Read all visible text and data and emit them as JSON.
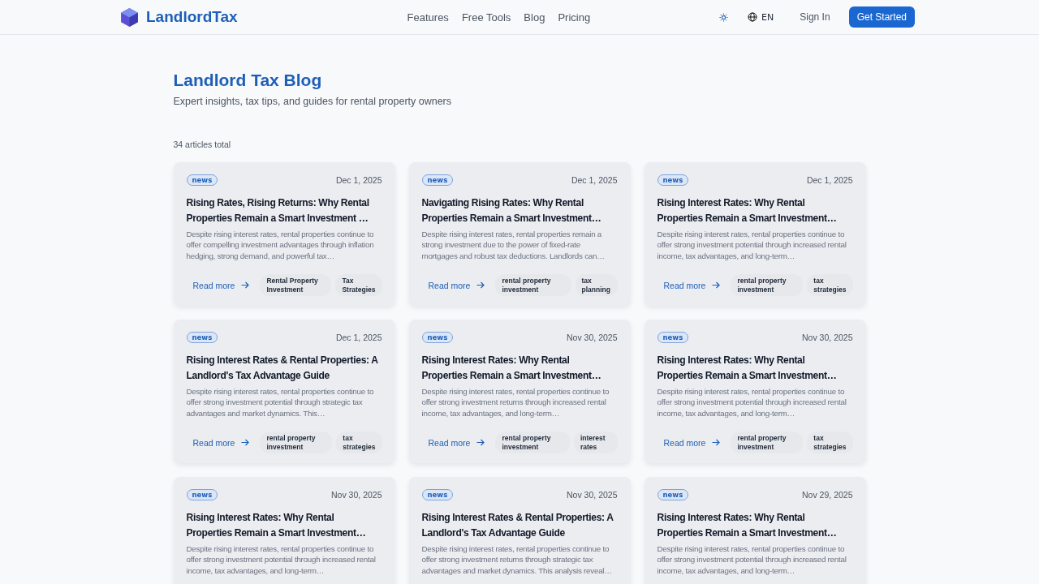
{
  "header": {
    "logo": "LandlordTax",
    "nav": [
      "Features",
      "Free Tools",
      "Blog",
      "Pricing"
    ],
    "language": "EN",
    "sign_in": "Sign In",
    "cta": "Get Started"
  },
  "page": {
    "title": "Landlord Tax Blog",
    "subtitle": "Expert insights, tax tips, and guides for rental property owners",
    "count": "34 articles total"
  },
  "articles": [
    {
      "category": "news",
      "date": "Dec 1, 2025",
      "title": "Rising Rates, Rising Returns: Why Rental Properties Remain a Smart Investment …",
      "excerpt": "Despite rising interest rates, rental properties continue to offer compelling investment advantages through inflation hedging, strong demand, and powerful tax…",
      "read_more": "Read more",
      "tags": [
        "Rental Property Investment",
        "Tax Strategies"
      ]
    },
    {
      "category": "news",
      "date": "Dec 1, 2025",
      "title": "Navigating Rising Rates: Why Rental Properties Remain a Smart Investment…",
      "excerpt": "Despite rising interest rates, rental properties remain a strong investment due to the power of fixed-rate mortgages and robust tax deductions. Landlords can…",
      "read_more": "Read more",
      "tags": [
        "rental property investment",
        "tax planning"
      ]
    },
    {
      "category": "news",
      "date": "Dec 1, 2025",
      "title": "Rising Interest Rates: Why Rental Properties Remain a Smart Investment…",
      "excerpt": "Despite rising interest rates, rental properties continue to offer strong investment potential through increased rental income, tax advantages, and long-term…",
      "read_more": "Read more",
      "tags": [
        "rental property investment",
        "tax strategies"
      ]
    },
    {
      "category": "news",
      "date": "Dec 1, 2025",
      "title": "Rising Interest Rates & Rental Properties: A Landlord's Tax Advantage Guide",
      "excerpt": "Despite rising interest rates, rental properties continue to offer strong investment potential through strategic tax advantages and market dynamics. This…",
      "read_more": "Read more",
      "tags": [
        "rental property investment",
        "tax strategies"
      ]
    },
    {
      "category": "news",
      "date": "Nov 30, 2025",
      "title": "Rising Interest Rates: Why Rental Properties Remain a Smart Investment…",
      "excerpt": "Despite rising interest rates, rental properties continue to offer strong investment returns through increased rental income, tax advantages, and long-term…",
      "read_more": "Read more",
      "tags": [
        "rental property investment",
        "interest rates"
      ]
    },
    {
      "category": "news",
      "date": "Nov 30, 2025",
      "title": "Rising Interest Rates: Why Rental Properties Remain a Smart Investment…",
      "excerpt": "Despite rising interest rates, rental properties continue to offer strong investment potential through increased rental income, tax advantages, and long-term…",
      "read_more": "Read more",
      "tags": [
        "rental property investment",
        "tax strategies"
      ]
    },
    {
      "category": "news",
      "date": "Nov 30, 2025",
      "title": "Rising Interest Rates: Why Rental Properties Remain a Smart Investment…",
      "excerpt": "Despite rising interest rates, rental properties continue to offer strong investment potential through increased rental income, tax advantages, and long-term…"
    },
    {
      "category": "news",
      "date": "Nov 30, 2025",
      "title": "Rising Interest Rates & Rental Properties: A Landlord's Tax Advantage Guide",
      "excerpt": "Despite rising interest rates, rental properties continue to offer strong investment returns through strategic tax advantages and market dynamics. This analysis reveal…"
    },
    {
      "category": "news",
      "date": "Nov 29, 2025",
      "title": "Rising Interest Rates: Why Rental Properties Remain a Smart Investment…",
      "excerpt": "Despite rising interest rates, rental properties continue to offer strong investment potential through increased rental income, tax advantages, and long-term…"
    }
  ]
}
